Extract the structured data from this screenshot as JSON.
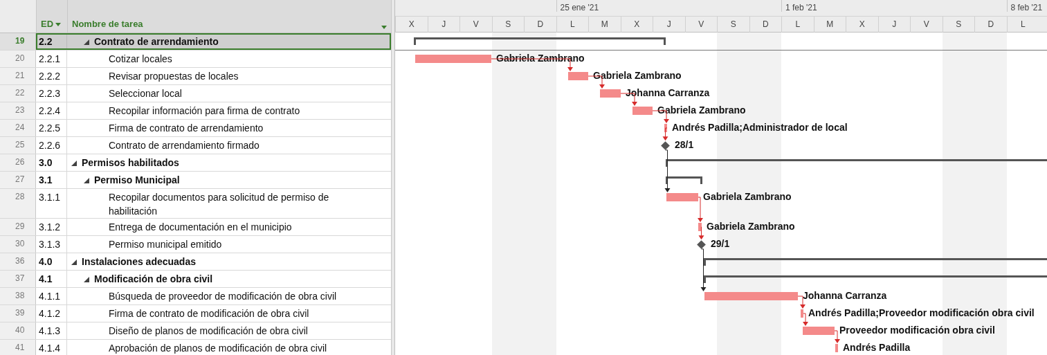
{
  "table": {
    "columns": {
      "wbs": "ED",
      "name": "Nombre de tarea"
    }
  },
  "timescale": {
    "days": [
      {
        "letter": "X"
      },
      {
        "letter": "J"
      },
      {
        "letter": "V"
      },
      {
        "letter": "S"
      },
      {
        "letter": "D"
      },
      {
        "letter": "L",
        "week_label": "25 ene '21"
      },
      {
        "letter": "M"
      },
      {
        "letter": "X"
      },
      {
        "letter": "J"
      },
      {
        "letter": "V"
      },
      {
        "letter": "S"
      },
      {
        "letter": "D"
      },
      {
        "letter": "L",
        "week_label": "1 feb '21"
      },
      {
        "letter": "M"
      },
      {
        "letter": "X"
      },
      {
        "letter": "J"
      },
      {
        "letter": "V"
      },
      {
        "letter": "S"
      },
      {
        "letter": "D"
      },
      {
        "letter": "L",
        "week_label": "8 feb '21"
      }
    ]
  },
  "outline": [
    {
      "children": [
        {
          "id": "19",
          "wbs": "2.2",
          "name": "Contrato de arrendamiento",
          "kind": "summary",
          "expanded": true,
          "selected": true,
          "children": [
            {
              "id": "20",
              "wbs": "2.2.1",
              "name": "Cotizar locales",
              "kind": "task",
              "selected": false,
              "gantt_label": "Gabriela Zambrano"
            },
            {
              "id": "21",
              "wbs": "2.2.2",
              "name": "Revisar propuestas de locales",
              "kind": "task",
              "selected": false,
              "gantt_label": "Gabriela Zambrano"
            },
            {
              "id": "22",
              "wbs": "2.2.3",
              "name": "Seleccionar local",
              "kind": "task",
              "selected": false,
              "gantt_label": "Johanna Carranza"
            },
            {
              "id": "23",
              "wbs": "2.2.4",
              "name": "Recopilar información para firma de contrato",
              "kind": "task",
              "selected": false,
              "gantt_label": "Gabriela Zambrano"
            },
            {
              "id": "24",
              "wbs": "2.2.5",
              "name": "Firma de contrato de arrendamiento",
              "kind": "task",
              "selected": false,
              "gantt_label": "Andrés Padilla;Administrador de local"
            },
            {
              "id": "25",
              "wbs": "2.2.6",
              "name": "Contrato de arrendamiento firmado",
              "kind": "milestone",
              "selected": false,
              "gantt_label": "28/1"
            }
          ]
        }
      ]
    },
    {
      "id": "26",
      "wbs": "3.0",
      "name": "Permisos habilitados",
      "kind": "summary",
      "expanded": true,
      "selected": false,
      "children": [
        {
          "id": "27",
          "wbs": "3.1",
          "name": "Permiso Municipal",
          "kind": "summary",
          "expanded": true,
          "selected": false,
          "children": [
            {
              "id": "28",
              "wbs": "3.1.1",
              "name": "Recopilar documentos para solicitud de permiso de habilitación",
              "kind": "task",
              "selected": false,
              "gantt_label": "Gabriela Zambrano"
            },
            {
              "id": "29",
              "wbs": "3.1.2",
              "name": "Entrega de documentación en el municipio",
              "kind": "task",
              "selected": false,
              "gantt_label": "Gabriela Zambrano"
            },
            {
              "id": "30",
              "wbs": "3.1.3",
              "name": "Permiso municipal emitido",
              "kind": "milestone",
              "selected": false,
              "gantt_label": "29/1"
            }
          ]
        }
      ]
    },
    {
      "id": "36",
      "wbs": "4.0",
      "name": "Instalaciones adecuadas",
      "kind": "summary",
      "expanded": true,
      "selected": false,
      "children": [
        {
          "id": "37",
          "wbs": "4.1",
          "name": "Modificación de obra civil",
          "kind": "summary",
          "expanded": true,
          "selected": false,
          "children": [
            {
              "id": "38",
              "wbs": "4.1.1",
              "name": "Búsqueda de proveedor de modificación de obra civil",
              "kind": "task",
              "selected": false,
              "gantt_label": "Johanna Carranza"
            },
            {
              "id": "39",
              "wbs": "4.1.2",
              "name": "Firma de contrato de modificación de obra civil",
              "kind": "task",
              "selected": false,
              "gantt_label": "Andrés Padilla;Proveedor modificación obra civil"
            },
            {
              "id": "40",
              "wbs": "4.1.3",
              "name": "Diseño de planos de modificación de obra civil",
              "kind": "task",
              "selected": false,
              "gantt_label": "Proveedor modificación obra civil"
            },
            {
              "id": "41",
              "wbs": "4.1.4",
              "name": "Aprobación de planos de modificación de obra civil",
              "kind": "task",
              "selected": false,
              "gantt_label": "Andrés Padilla"
            }
          ]
        }
      ]
    }
  ]
}
